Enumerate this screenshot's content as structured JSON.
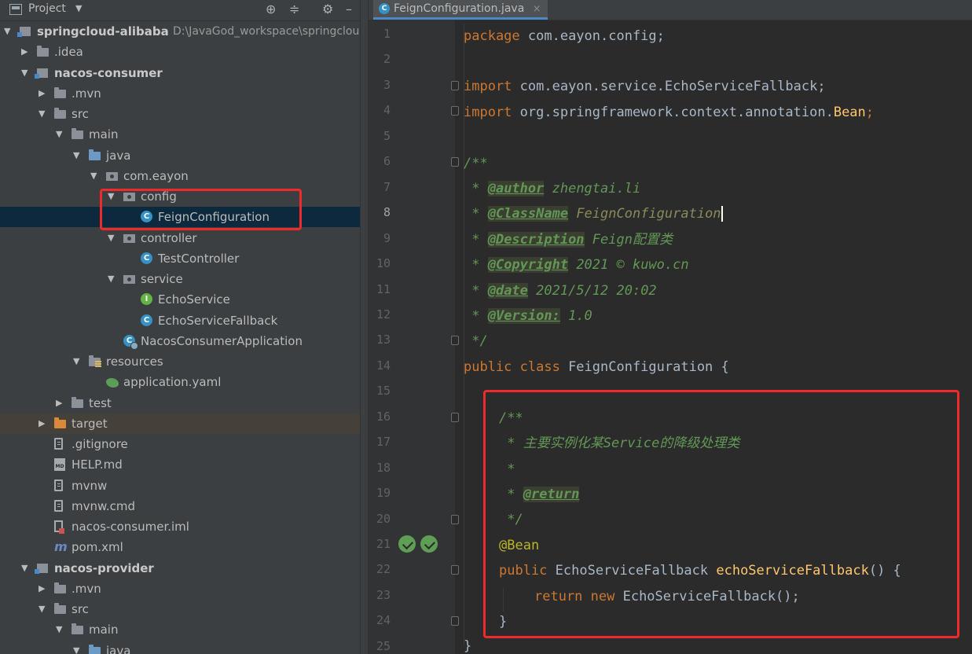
{
  "project_panel": {
    "title": "Project",
    "tool_icons": [
      "locate-icon",
      "collapse-icon",
      "gear-icon",
      "minimize-icon"
    ],
    "tree": [
      {
        "label": "springcloud-alibaba",
        "path": "D:\\JavaGod_workspace\\springcloud",
        "expanded": true,
        "icon": "module-icon",
        "bold": true
      },
      {
        "label": ".idea",
        "expanded": false,
        "icon": "folder-icon"
      },
      {
        "label": "nacos-consumer",
        "expanded": true,
        "icon": "module-icon",
        "bold": true
      },
      {
        "label": ".mvn",
        "expanded": false,
        "icon": "folder-icon"
      },
      {
        "label": "src",
        "expanded": true,
        "icon": "folder-icon"
      },
      {
        "label": "main",
        "expanded": true,
        "icon": "folder-icon"
      },
      {
        "label": "java",
        "expanded": true,
        "icon": "source-folder-icon"
      },
      {
        "label": "com.eayon",
        "expanded": true,
        "icon": "package-icon"
      },
      {
        "label": "config",
        "expanded": true,
        "icon": "package-icon"
      },
      {
        "label": "FeignConfiguration",
        "icon": "class-icon",
        "selected": true
      },
      {
        "label": "controller",
        "expanded": true,
        "icon": "package-icon"
      },
      {
        "label": "TestController",
        "icon": "class-icon"
      },
      {
        "label": "service",
        "expanded": true,
        "icon": "package-icon"
      },
      {
        "label": "EchoService",
        "icon": "interface-icon"
      },
      {
        "label": "EchoServiceFallback",
        "icon": "class-icon"
      },
      {
        "label": "NacosConsumerApplication",
        "icon": "spring-app-icon"
      },
      {
        "label": "resources",
        "expanded": true,
        "icon": "resources-folder-icon"
      },
      {
        "label": "application.yaml",
        "icon": "yaml-icon"
      },
      {
        "label": "test",
        "expanded": false,
        "icon": "folder-icon"
      },
      {
        "label": "target",
        "expanded": false,
        "icon": "excluded-folder-icon"
      },
      {
        "label": ".gitignore",
        "icon": "text-file-icon"
      },
      {
        "label": "HELP.md",
        "icon": "markdown-icon"
      },
      {
        "label": "mvnw",
        "icon": "text-file-icon"
      },
      {
        "label": "mvnw.cmd",
        "icon": "text-file-icon"
      },
      {
        "label": "nacos-consumer.iml",
        "icon": "iml-file-icon"
      },
      {
        "label": "pom.xml",
        "icon": "maven-icon"
      },
      {
        "label": "nacos-provider",
        "expanded": true,
        "icon": "module-icon",
        "bold": true
      },
      {
        "label": ".mvn",
        "expanded": false,
        "icon": "folder-icon"
      },
      {
        "label": "src",
        "expanded": true,
        "icon": "folder-icon"
      },
      {
        "label": "main",
        "expanded": true,
        "icon": "folder-icon"
      },
      {
        "label": "java",
        "expanded": true,
        "icon": "source-folder-icon"
      }
    ]
  },
  "editor": {
    "tab": {
      "label": "FeignConfiguration.java",
      "close": "×"
    },
    "line_numbers": [
      "1",
      "2",
      "3",
      "4",
      "5",
      "6",
      "7",
      "8",
      "9",
      "10",
      "11",
      "12",
      "13",
      "14",
      "15",
      "16",
      "17",
      "18",
      "19",
      "20",
      "21",
      "22",
      "23",
      "24",
      "25"
    ],
    "current_line": "8",
    "code": {
      "l1_kw": "package",
      "l1_rest": " com.eayon.config;",
      "l3_kw": "import",
      "l3_rest": " com.eayon.service.EchoServiceFallback;",
      "l4_kw": "import",
      "l4_rest": " org.springframework.context.annotation.",
      "l4_cls": "Bean",
      "l4_semi": ";",
      "l6": "/**",
      "l7_pre": " * ",
      "l7_tag": "@author",
      "l7_val": " zhengtai.li",
      "l8_pre": " * ",
      "l8_tag": "@ClassName",
      "l8_val": " FeignConfiguration",
      "l9_pre": " * ",
      "l9_tag": "@Description",
      "l9_val": " Feign配置类",
      "l10_pre": " * ",
      "l10_tag": "@Copyright",
      "l10_val": " 2021 © kuwo.cn",
      "l11_pre": " * ",
      "l11_tag": "@date",
      "l11_val": " 2021/5/12 20:02",
      "l12_pre": " * ",
      "l12_tag": "@Version:",
      "l12_val": " 1.0",
      "l13": " */",
      "l14_kw": "public class",
      "l14_rest": " FeignConfiguration {",
      "l16": "/**",
      "l17": " * 主要实例化某Service的降级处理类",
      "l18": " *",
      "l19_pre": " * ",
      "l19_tag": "@return",
      "l20": " */",
      "l21": "@Bean",
      "l22_kw": "public",
      "l22_type": " EchoServiceFallback ",
      "l22_fn": "echoServiceFallback",
      "l22_rest": "() {",
      "l23_kw": "return new",
      "l23_rest": " EchoServiceFallback();",
      "l23_semi": "",
      "l24": "}",
      "l25": "}"
    }
  },
  "colors": {
    "keyword": "#cc7832",
    "method": "#ffc66d",
    "annotation": "#bbb529",
    "doc_comment": "#629755",
    "highlight_box": "#ee2a2a",
    "selection": "#0d293e"
  }
}
